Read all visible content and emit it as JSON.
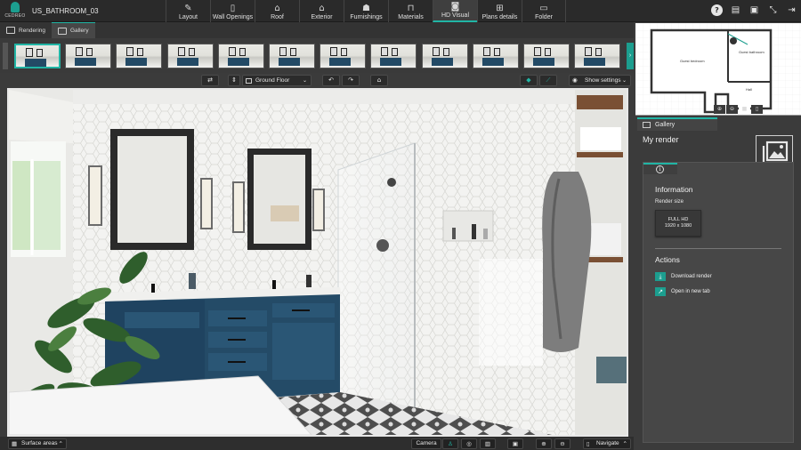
{
  "app": {
    "logo_text": "CEDREO",
    "project_name": "US_BATHROOM_03"
  },
  "nav": {
    "tabs": [
      {
        "label": "Layout",
        "icon": "pencil-icon"
      },
      {
        "label": "Wall Openings",
        "icon": "door-icon"
      },
      {
        "label": "Roof",
        "icon": "roof-icon"
      },
      {
        "label": "Exterior",
        "icon": "house-icon"
      },
      {
        "label": "Furnishings",
        "icon": "lamp-icon"
      },
      {
        "label": "Materials",
        "icon": "paint-roller-icon"
      },
      {
        "label": "HD Visual",
        "icon": "camera-icon"
      },
      {
        "label": "Plans details",
        "icon": "plans-icon"
      },
      {
        "label": "Folder",
        "icon": "folder-icon"
      }
    ],
    "active_tab": "HD Visual"
  },
  "top_icons": [
    "help-icon",
    "comment-icon",
    "save-icon",
    "fullscreen-icon",
    "logout-icon"
  ],
  "subtabs": [
    {
      "label": "Rendering"
    },
    {
      "label": "Gallery"
    }
  ],
  "gallery": {
    "thumbnail_count": 12,
    "selected_index": 0
  },
  "viewer_toolbar": {
    "floor_select": "Ground Floor",
    "show_settings": "Show settings"
  },
  "bottom_bar": {
    "surface_areas": "Surface areas",
    "camera": "Camera",
    "navigate": "Navigate"
  },
  "minimap": {
    "rooms": [
      "Guest bedroom",
      "Guest bathroom",
      "Hall"
    ]
  },
  "panel": {
    "tab_label": "Gallery",
    "title": "My render",
    "info_title": "Information",
    "render_size_label": "Render size",
    "render_size_name": "FULL HD",
    "render_size_value": "1920 x 1080",
    "actions_title": "Actions",
    "actions": [
      {
        "label": "Download render",
        "icon": "download-icon"
      },
      {
        "label": "Open in new tab",
        "icon": "external-link-icon"
      }
    ]
  },
  "colors": {
    "accent": "#1c9e8f",
    "topbar": "#2a2a2a",
    "panel": "#3b3b3b",
    "vanity": "#234a66"
  }
}
